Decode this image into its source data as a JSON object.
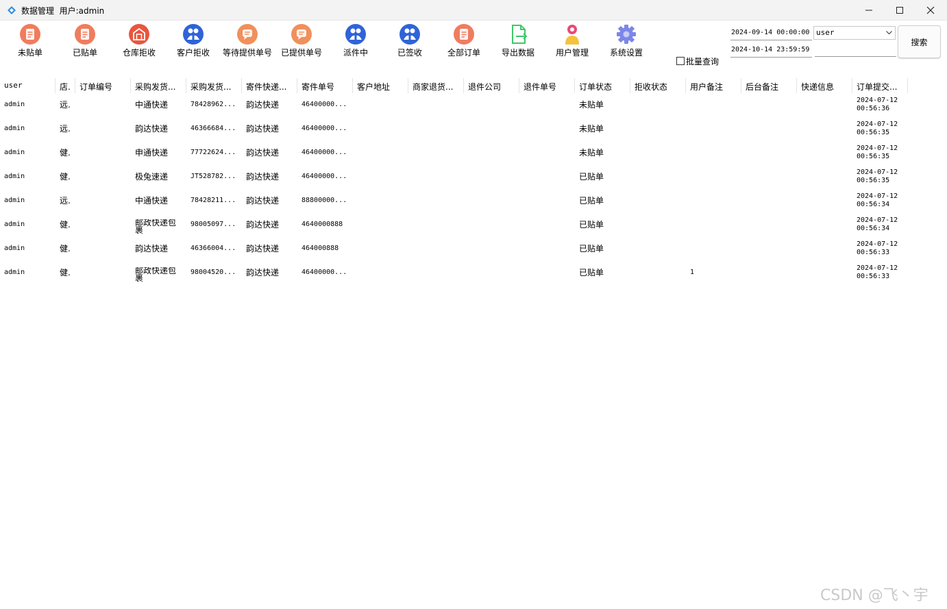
{
  "window": {
    "title": "数据管理  用户:admin"
  },
  "toolbar": {
    "buttons": [
      {
        "label": "未贴单",
        "icon": "clipboard-icon",
        "color": "#ee6a4f"
      },
      {
        "label": "已贴单",
        "icon": "clipboard-icon",
        "color": "#ee6a4f"
      },
      {
        "label": "仓库拒收",
        "icon": "warehouse-reject-icon",
        "color": "#e9553e"
      },
      {
        "label": "客户拒收",
        "icon": "customer-reject-icon",
        "color": "#2f63d8"
      },
      {
        "label": "等待提供单号",
        "icon": "chat-bubble-icon",
        "color": "#f0905c"
      },
      {
        "label": "已提供单号",
        "icon": "chat-bubble-icon",
        "color": "#f0905c"
      },
      {
        "label": "派件中",
        "icon": "people-icon",
        "color": "#2f63d8"
      },
      {
        "label": "已签收",
        "icon": "people-icon",
        "color": "#2f63d8"
      },
      {
        "label": "全部订单",
        "icon": "clipboard-icon",
        "color": "#ee6a4f"
      },
      {
        "label": "导出数据",
        "icon": "export-file-icon",
        "color": "#3fc76a"
      },
      {
        "label": "用户管理",
        "icon": "user-icon",
        "color": "#e84a78"
      },
      {
        "label": "系统设置",
        "icon": "gear-icon",
        "color": "#7d86e8"
      }
    ]
  },
  "filters": {
    "start_date": "2024-09-14 00:00:00",
    "end_date": "2024-10-14 23:59:59",
    "user_select": "user",
    "search_text": "",
    "batch_query_label": "批量查询",
    "batch_query_checked": false,
    "search_button": "搜索"
  },
  "table": {
    "columns": [
      "user",
      "店.",
      "订单编号",
      "采购发货...",
      "采购发货...",
      "寄件快递...",
      "寄件单号",
      "客户地址",
      "商家退货...",
      "退件公司",
      "退件单号",
      "订单状态",
      "拒收状态",
      "用户备注",
      "后台备注",
      "快递信息",
      "订单提交..."
    ],
    "rows": [
      [
        "admin",
        "远.",
        "",
        "中通快递",
        "78428962...",
        "韵达快递",
        "46400000...",
        "",
        "",
        "",
        "",
        "未贴单",
        "",
        "",
        "",
        "",
        "2024-07-12 00:56:36"
      ],
      [
        "admin",
        "远.",
        "",
        "韵达快递",
        "46366684...",
        "韵达快递",
        "46400000...",
        "",
        "",
        "",
        "",
        "未贴单",
        "",
        "",
        "",
        "",
        "2024-07-12 00:56:35"
      ],
      [
        "admin",
        "健.",
        "",
        "申通快递",
        "77722624...",
        "韵达快递",
        "46400000...",
        "",
        "",
        "",
        "",
        "未贴单",
        "",
        "",
        "",
        "",
        "2024-07-12 00:56:35"
      ],
      [
        "admin",
        "健.",
        "",
        "极兔速递",
        "JT528782...",
        "韵达快递",
        "46400000...",
        "",
        "",
        "",
        "",
        "已贴单",
        "",
        "",
        "",
        "",
        "2024-07-12 00:56:35"
      ],
      [
        "admin",
        "远.",
        "",
        "中通快递",
        "78428211...",
        "韵达快递",
        "88800000...",
        "",
        "",
        "",
        "",
        "已贴单",
        "",
        "",
        "",
        "",
        "2024-07-12 00:56:34"
      ],
      [
        "admin",
        "健.",
        "",
        "邮政快递包裹",
        "98005097...",
        "韵达快递",
        "4640000888",
        "",
        "",
        "",
        "",
        "已贴单",
        "",
        "",
        "",
        "",
        "2024-07-12 00:56:34"
      ],
      [
        "admin",
        "健.",
        "",
        "韵达快递",
        "46366004...",
        "韵达快递",
        "464000888",
        "",
        "",
        "",
        "",
        "已贴单",
        "",
        "",
        "",
        "",
        "2024-07-12 00:56:33"
      ],
      [
        "admin",
        "健.",
        "",
        "邮政快递包裹",
        "98004520...",
        "韵达快递",
        "46400000...",
        "",
        "",
        "",
        "",
        "已贴单",
        "",
        "1",
        "",
        "",
        "2024-07-12 00:56:33"
      ]
    ]
  },
  "watermark": "CSDN @飞丶宇"
}
